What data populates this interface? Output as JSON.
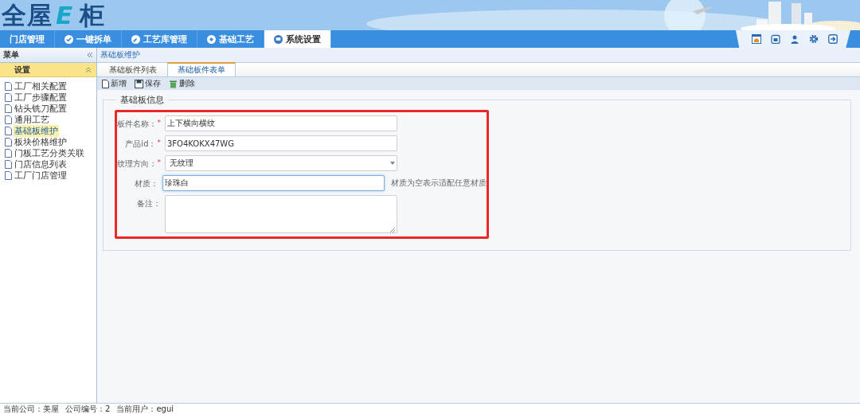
{
  "logo": {
    "main": "全屋",
    "accent": "E",
    "end": "柜"
  },
  "nav_tabs": [
    {
      "label": "门店管理",
      "selected": false
    },
    {
      "label": "一键拆单",
      "selected": false
    },
    {
      "label": "工艺库管理",
      "selected": false
    },
    {
      "label": "基础工艺",
      "selected": false
    },
    {
      "label": "系统设置",
      "selected": true
    }
  ],
  "sidebar": {
    "title": "菜单",
    "section": {
      "label": "设置",
      "expanded": true
    },
    "items": [
      {
        "label": "工厂相关配置",
        "selected": false
      },
      {
        "label": "工厂步骤配置",
        "selected": false
      },
      {
        "label": "钻头铣刀配置",
        "selected": false
      },
      {
        "label": "通用工艺",
        "selected": false
      },
      {
        "label": "基础板维护",
        "selected": true
      },
      {
        "label": "板块价格维护",
        "selected": false
      },
      {
        "label": "门板工艺分类关联",
        "selected": false
      },
      {
        "label": "门店信息列表",
        "selected": false
      },
      {
        "label": "工厂门店管理",
        "selected": false
      }
    ]
  },
  "breadcrumb": "基础板维护",
  "tabs": [
    {
      "label": "基础板件列表",
      "selected": false
    },
    {
      "label": "基础板件表单",
      "selected": true
    }
  ],
  "toolbar": [
    "新增",
    "保存",
    "删除"
  ],
  "form": {
    "legend": "基础板信息",
    "highlighted": true,
    "fields": [
      {
        "kind": "text",
        "label": "板件名称：",
        "required_mark": "*",
        "value": "上下横向横纹",
        "focused": false
      },
      {
        "kind": "text",
        "label": "产品id：",
        "required_mark": "*",
        "value": "3FO4KOKX47WG",
        "focused": false
      },
      {
        "kind": "select",
        "label": "纹理方向：",
        "required_mark": "*",
        "value": "无纹理",
        "focused": false
      },
      {
        "kind": "text",
        "label": "材质：",
        "value": "珍珠白",
        "focused": true,
        "hint": "材质为空表示适配任意材质"
      },
      {
        "kind": "textarea",
        "label": "备注：",
        "focused": false
      }
    ]
  },
  "status_bar": [
    "当前公司：美屋",
    "公司编号：2",
    "当前用户：egui"
  ]
}
